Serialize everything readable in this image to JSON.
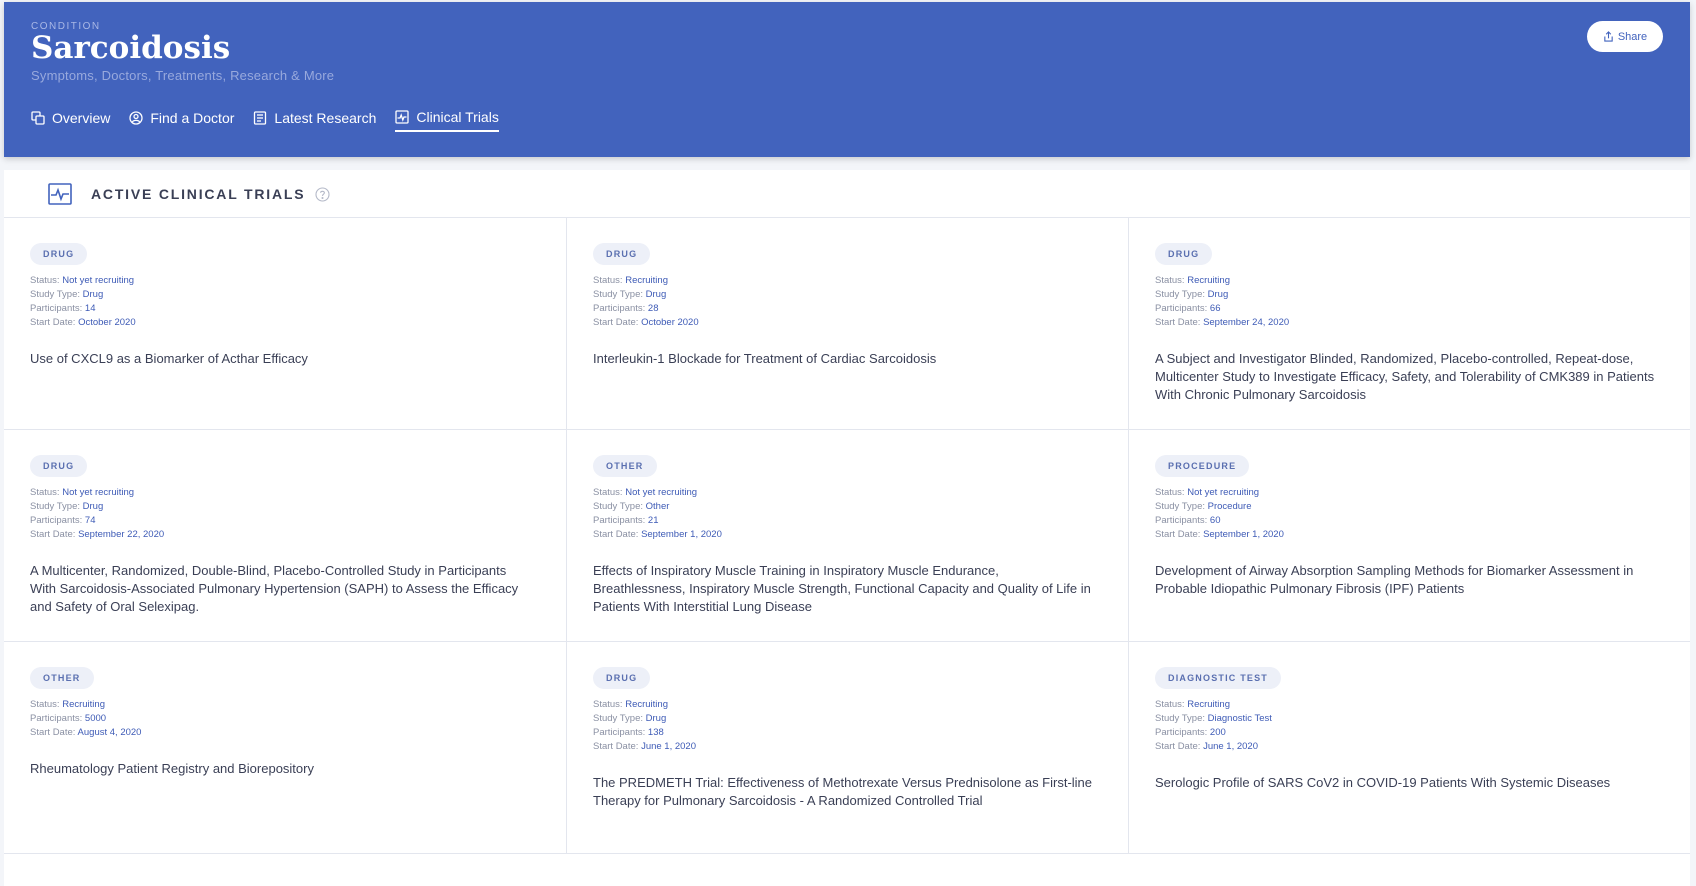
{
  "header": {
    "eyebrow": "CONDITION",
    "title": "Sarcoidosis",
    "subtitle": "Symptoms, Doctors, Treatments, Research & More",
    "share_label": "Share",
    "nav": [
      {
        "label": "Overview",
        "icon": "copy-icon"
      },
      {
        "label": "Find a Doctor",
        "icon": "user-circle-icon"
      },
      {
        "label": "Latest Research",
        "icon": "document-icon"
      },
      {
        "label": "Clinical Trials",
        "icon": "pulse-chart-icon",
        "active": true
      }
    ]
  },
  "section": {
    "title": "ACTIVE CLINICAL TRIALS",
    "icon": "heartbeat-icon"
  },
  "labels": {
    "status": "Status:",
    "study_type": "Study Type:",
    "participants": "Participants:",
    "start_date": "Start Date:"
  },
  "trials": [
    {
      "tag": "DRUG",
      "status": "Not yet recruiting",
      "study_type": "Drug",
      "participants": "14",
      "start_date": "October 2020",
      "title": "Use of CXCL9 as a Biomarker of Acthar Efficacy"
    },
    {
      "tag": "DRUG",
      "status": "Recruiting",
      "study_type": "Drug",
      "participants": "28",
      "start_date": "October 2020",
      "title": "Interleukin-1 Blockade for Treatment of Cardiac Sarcoidosis"
    },
    {
      "tag": "DRUG",
      "status": "Recruiting",
      "study_type": "Drug",
      "participants": "66",
      "start_date": "September 24, 2020",
      "title": "A Subject and Investigator Blinded, Randomized, Placebo-controlled, Repeat-dose, Multicenter Study to Investigate Efficacy, Safety, and Tolerability of CMK389 in Patients With Chronic Pulmonary Sarcoidosis"
    },
    {
      "tag": "DRUG",
      "status": "Not yet recruiting",
      "study_type": "Drug",
      "participants": "74",
      "start_date": "September 22, 2020",
      "title": "A Multicenter, Randomized, Double-Blind, Placebo-Controlled Study in Participants With Sarcoidosis-Associated Pulmonary Hypertension (SAPH) to Assess the Efficacy and Safety of Oral Selexipag."
    },
    {
      "tag": "OTHER",
      "status": "Not yet recruiting",
      "study_type": "Other",
      "participants": "21",
      "start_date": "September 1, 2020",
      "title": "Effects of Inspiratory Muscle Training in Inspiratory Muscle Endurance, Breathlessness, Inspiratory Muscle Strength, Functional Capacity and Quality of Life in Patients With Interstitial Lung Disease"
    },
    {
      "tag": "PROCEDURE",
      "status": "Not yet recruiting",
      "study_type": "Procedure",
      "participants": "60",
      "start_date": "September 1, 2020",
      "title": "Development of Airway Absorption Sampling Methods for Biomarker Assessment in Probable Idiopathic Pulmonary Fibrosis (IPF) Patients"
    },
    {
      "tag": "OTHER",
      "status": "Recruiting",
      "study_type": null,
      "participants": "5000",
      "start_date": "August 4, 2020",
      "title": "Rheumatology Patient Registry and Biorepository"
    },
    {
      "tag": "DRUG",
      "status": "Recruiting",
      "study_type": "Drug",
      "participants": "138",
      "start_date": "June 1, 2020",
      "title": "The PREDMETH Trial: Effectiveness of Methotrexate Versus Prednisolone as First-line Therapy for Pulmonary Sarcoidosis - A Randomized Controlled Trial"
    },
    {
      "tag": "DIAGNOSTIC TEST",
      "status": "Recruiting",
      "study_type": "Diagnostic Test",
      "participants": "200",
      "start_date": "June 1, 2020",
      "title": "Serologic Profile of SARS CoV2 in COVID-19 Patients With Systemic Diseases"
    }
  ]
}
